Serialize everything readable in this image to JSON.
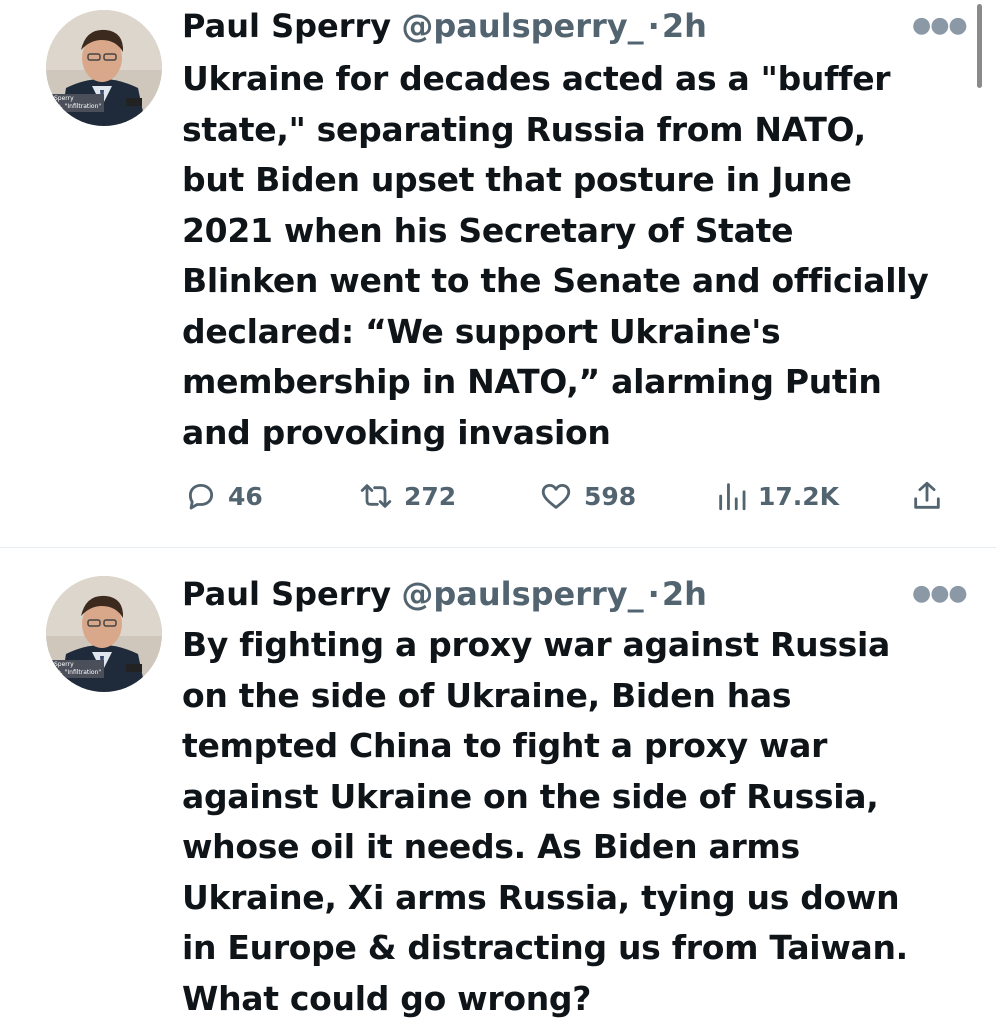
{
  "tweets": [
    {
      "author_name": "Paul Sperry",
      "handle": "@paulsperry_",
      "separator": "·",
      "time": "2h",
      "more_icon": "more-horizontal-icon",
      "avatar_caption": "Sperry\nse, \"Infiltration\"",
      "text": "Ukraine for decades acted as a \"buffer\nstate,\" separating  Russia from NATO,\nbut Biden upset that posture in June\n2021 when his Secretary of State\nBlinken went to the Senate and officially\ndeclared: “We support Ukraine's\nmembership in NATO,” alarming Putin\nand provoking invasion",
      "stats": {
        "replies": "46",
        "retweets": "272",
        "likes": "598",
        "views": "17.2K"
      }
    },
    {
      "author_name": "Paul Sperry",
      "handle": "@paulsperry_",
      "separator": "·",
      "time": "2h",
      "more_icon": "more-horizontal-icon",
      "avatar_caption": "Sperry\nse, \"Infiltration\"",
      "text": "By fighting a proxy war against Russia\non the side of Ukraine, Biden has\ntempted China to fight a proxy war\nagainst Ukraine on the side of Russia,\nwhose oil it needs. As Biden arms\nUkraine, Xi arms Russia, tying us down\nin Europe & distracting us from Taiwan.\nWhat could go wrong?"
    }
  ],
  "colors": {
    "text_primary": "#0f1419",
    "text_secondary": "#536471",
    "divider": "#e6ecf0"
  }
}
